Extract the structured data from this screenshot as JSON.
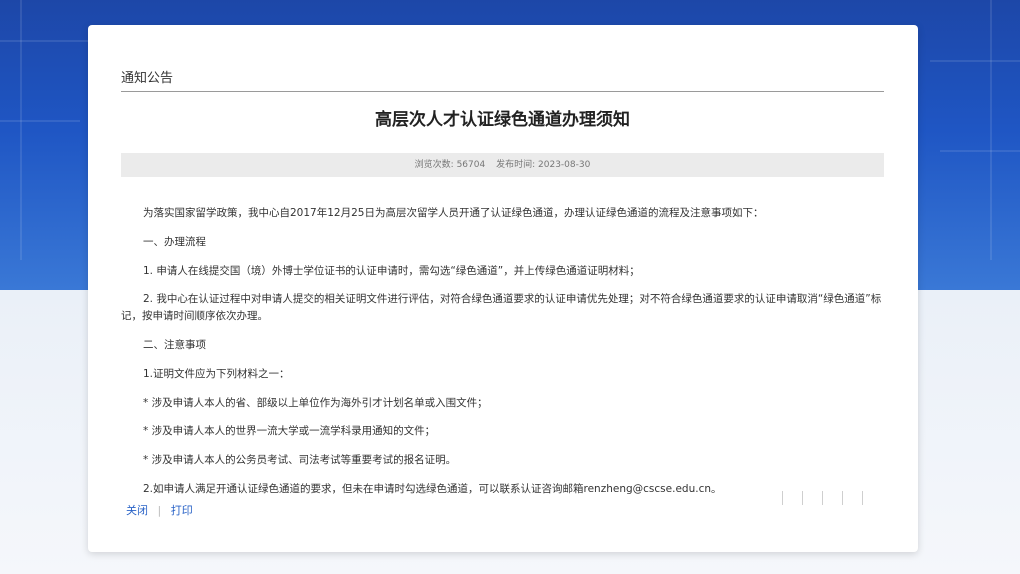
{
  "page": {
    "breadcrumb": "通知公告",
    "title": "高层次人才认证绿色通道办理须知",
    "meta": {
      "views_label": "浏览次数:",
      "views": "56704",
      "date_label": "发布时间:",
      "date": "2023-08-30"
    },
    "paragraphs": [
      "为落实国家留学政策，我中心自2017年12月25日为高层次留学人员开通了认证绿色通道，办理认证绿色通道的流程及注意事项如下：",
      "一、办理流程",
      "1. 申请人在线提交国（境）外博士学位证书的认证申请时，需勾选“绿色通道”，并上传绿色通道证明材料；",
      "2. 我中心在认证过程中对申请人提交的相关证明文件进行评估，对符合绿色通道要求的认证申请优先处理；对不符合绿色通道要求的认证申请取消“绿色通道”标记，按申请时间顺序依次办理。",
      "二、注意事项",
      "1.证明文件应为下列材料之一：",
      "* 涉及申请人本人的省、部级以上单位作为海外引才计划名单或入围文件；",
      "* 涉及申请人本人的世界一流大学或一流学科录用通知的文件；",
      "* 涉及申请人本人的公务员考试、司法考试等重要考试的报名证明。",
      "2.如申请人满足开通认证绿色通道的要求，但未在申请时勾选绿色通道，可以联系认证咨询邮箱renzheng@cscse.edu.cn。"
    ],
    "footer": {
      "close": "关闭",
      "print": "打印"
    }
  }
}
